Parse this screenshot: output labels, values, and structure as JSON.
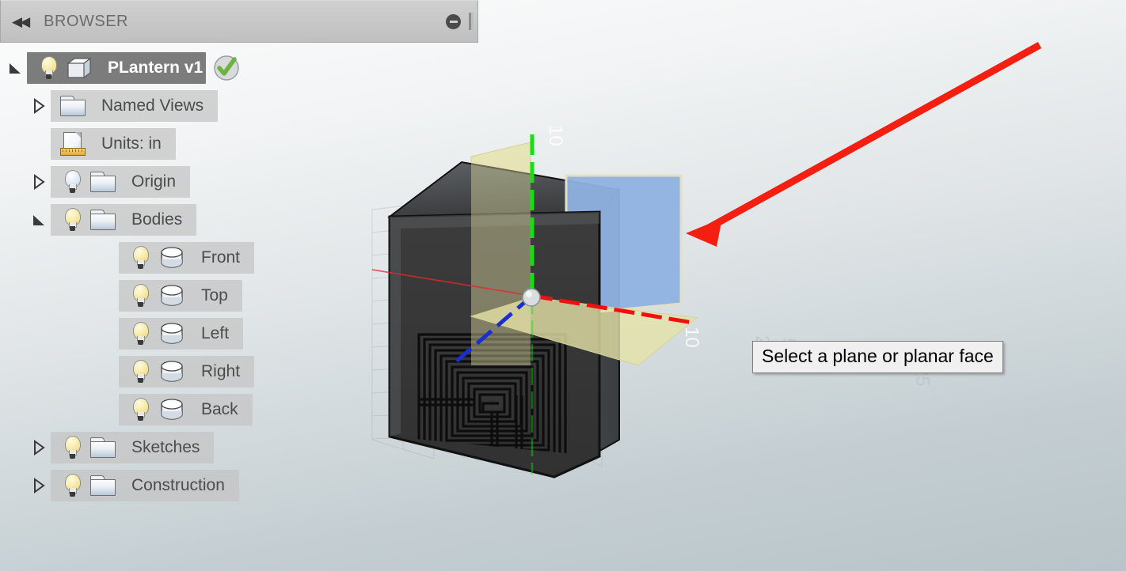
{
  "app": {
    "viewport_background_top": "#fdfdfd",
    "viewport_background_bottom": "#b8c4c9"
  },
  "browser": {
    "title": "BROWSER",
    "collapse_icon": "double-left-arrows",
    "minimize_icon": "minimize-circle",
    "grip_icon": "panel-grip"
  },
  "tree": [
    {
      "label": "PLantern v1",
      "indent": 0,
      "twisty": "open",
      "bulb": "on",
      "icon": "cube-icon",
      "selected": true,
      "badge": "green-check"
    },
    {
      "label": "Named Views",
      "indent": 1,
      "twisty": "closed",
      "bulb": "none",
      "icon": "folder-icon",
      "selected": false
    },
    {
      "label": "Units: in",
      "indent": 1,
      "twisty": "none",
      "bulb": "none",
      "icon": "document-ruler-icon",
      "selected": false
    },
    {
      "label": "Origin",
      "indent": 1,
      "twisty": "closed",
      "bulb": "off",
      "icon": "folder-icon",
      "selected": false
    },
    {
      "label": "Bodies",
      "indent": 1,
      "twisty": "open",
      "bulb": "on",
      "icon": "folder-icon",
      "selected": false
    },
    {
      "label": "Front",
      "indent": 2,
      "twisty": "none",
      "bulb": "on",
      "icon": "body-icon",
      "selected": false
    },
    {
      "label": "Top",
      "indent": 2,
      "twisty": "none",
      "bulb": "on",
      "icon": "body-icon",
      "selected": false
    },
    {
      "label": "Left",
      "indent": 2,
      "twisty": "none",
      "bulb": "on",
      "icon": "body-icon",
      "selected": false
    },
    {
      "label": "Right",
      "indent": 2,
      "twisty": "none",
      "bulb": "on",
      "icon": "body-icon",
      "selected": false
    },
    {
      "label": "Back",
      "indent": 2,
      "twisty": "none",
      "bulb": "on",
      "icon": "body-icon",
      "selected": false
    },
    {
      "label": "Sketches",
      "indent": 1,
      "twisty": "closed",
      "bulb": "on",
      "icon": "folder-icon",
      "selected": false
    },
    {
      "label": "Construction",
      "indent": 1,
      "twisty": "closed",
      "bulb": "on",
      "icon": "folder-icon",
      "selected": false
    }
  ],
  "tooltip": {
    "text": "Select a plane or planar face"
  },
  "annotation": {
    "arrow_color": "#f41f10",
    "arrow_from": "top-right",
    "arrow_to": "blue-origin-plane"
  },
  "viewport": {
    "axis_labels": [
      "10",
      "10",
      "25",
      "2"
    ],
    "axes": [
      {
        "name": "z-axis",
        "color": "#12e012"
      },
      {
        "name": "x-axis",
        "color": "#f01010"
      },
      {
        "name": "y-axis",
        "color": "#1a2fd0"
      }
    ],
    "planes": [
      {
        "name": "xy-origin-plane",
        "color": "#8fb2e0"
      },
      {
        "name": "xz-origin-plane",
        "color": "#e3e0a8"
      },
      {
        "name": "yz-origin-plane",
        "color": "#e3e0a8"
      }
    ],
    "body": {
      "name": "lantern-body",
      "color": "#3c3c3c",
      "pattern": "labyrinth-spiral"
    }
  }
}
